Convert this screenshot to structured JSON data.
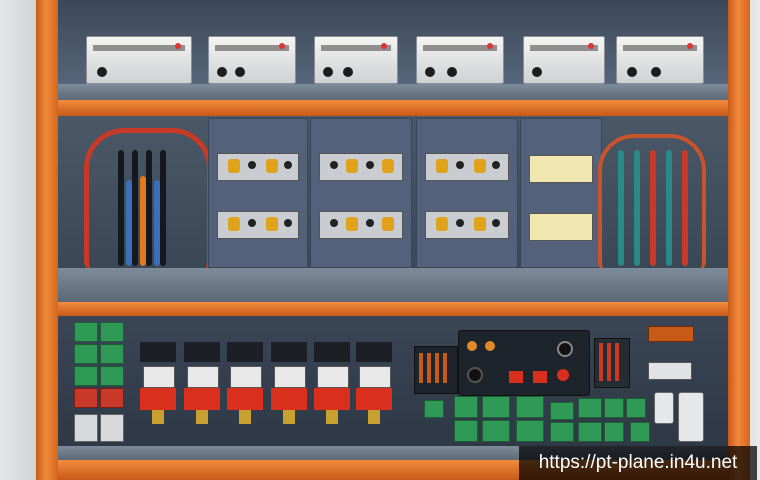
{
  "image": {
    "subject": "electrical control cabinet",
    "watermark_url": "https://pt-plane.in4u.net"
  },
  "colors": {
    "frame_orange": "#e8792a",
    "cabinet_slate": "#4a5868",
    "breaker_red": "#d9301e",
    "terminal_green": "#2f9a55"
  }
}
